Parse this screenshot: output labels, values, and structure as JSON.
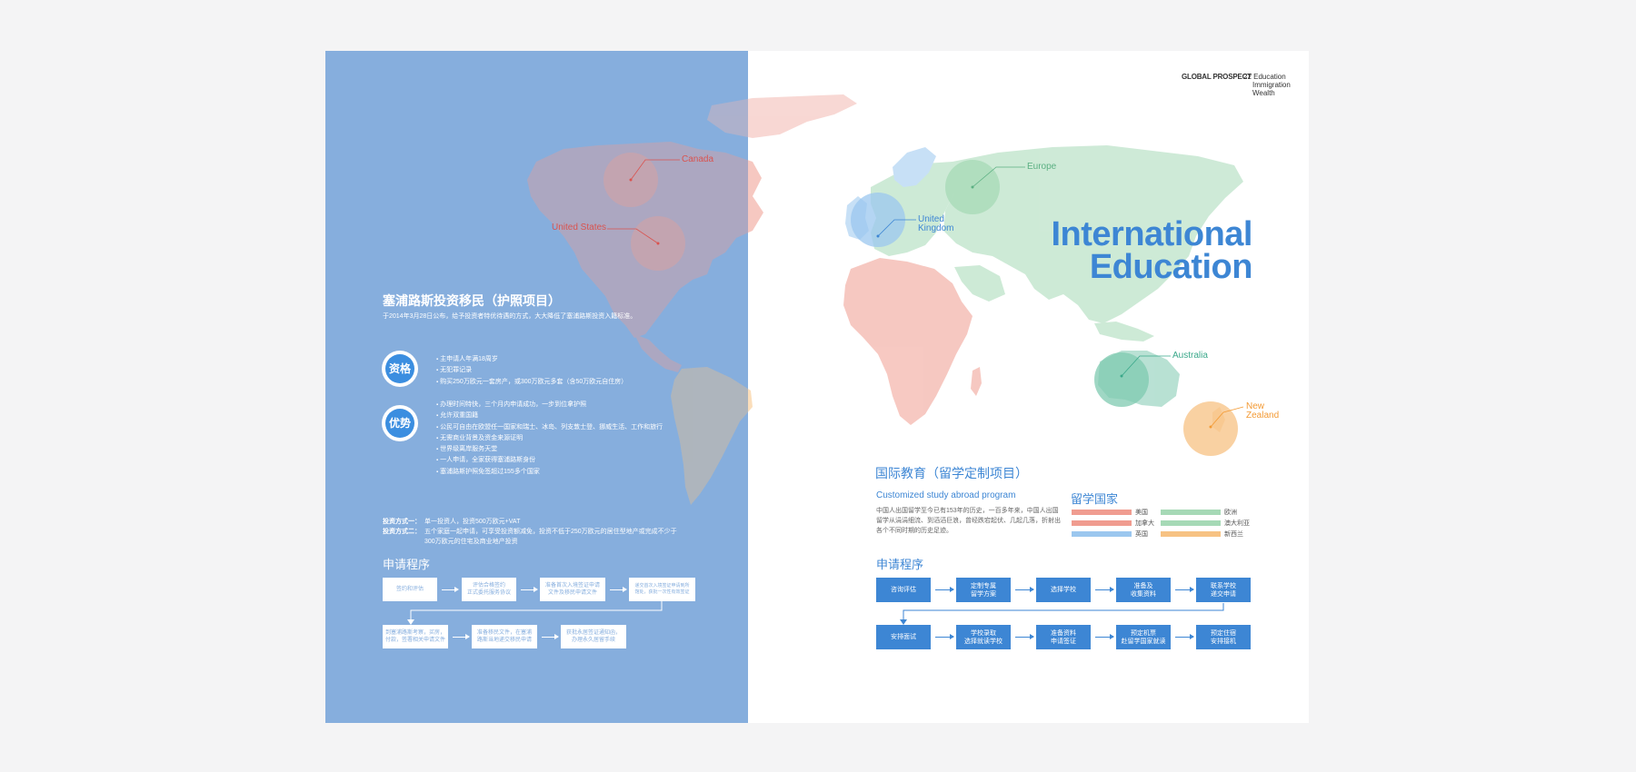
{
  "header": {
    "brand": "GLOBAL PROSPECT",
    "categories": [
      "22 Education",
      "Immigration",
      "Wealth"
    ]
  },
  "title": {
    "line1": "International",
    "line2": "Education"
  },
  "map_labels": {
    "canada": "Canada",
    "us": "United States",
    "europe": "Europe",
    "uk1": "United",
    "uk2": "Kingdom",
    "australia": "Australia",
    "nz1": "New",
    "nz2": "Zealand"
  },
  "colors": {
    "left_panel": "#86aede",
    "accent_blue": "#3d86d4",
    "na_red": "#f09c90",
    "europe_green": "#a6d9b6",
    "uk_blue": "#9bc7ef",
    "nz_orange": "#f7c283",
    "australia_teal": "#7fc9b0"
  },
  "left": {
    "title": "塞浦路斯投资移民（护照项目）",
    "subtitle": "于2014年3月28日公布，给予投资者特优待遇的方式，大大降低了塞浦路斯投资入籍标准。",
    "qual_badge": "资格",
    "qual_items": [
      "主申请人年满18周岁",
      "无犯罪记录",
      "购买250万欧元一套房产，或300万欧元多套（含50万欧元自住房）"
    ],
    "adv_badge": "优势",
    "adv_items": [
      "办理时间特快，三个月内申请成功，一步到位拿护照",
      "允许双重国籍",
      "公民可自由在欧盟任一国家和瑞士、冰岛、列支敦士登、挪威生活、工作和旅行",
      "无需商业背景及资金来源证明",
      "世界级离岸服务天堂",
      "一人申请，全家获得塞浦路斯身份",
      "塞浦路斯护照免签超过155多个国家"
    ],
    "invest_1_key": "投资方式一：",
    "invest_1_val": "单一投资人，投资500万欧元+VAT",
    "invest_2_key": "投资方式二：",
    "invest_2_val": "五个家庭一起申请，可享受投资额减免，投资不低于250万欧元的居住型地产或完成不少于",
    "invest_2_val2": "300万欧元的住宅及商业地产投资",
    "process_title": "申请程序",
    "steps": [
      [
        "签约和评估"
      ],
      [
        "评估合格签约",
        "正式委托服务协议"
      ],
      [
        "准备首次入境签证申请",
        "文件及移民申请文件"
      ],
      [
        "递交首次入境签证申请到所",
        "馆处，获批一次性有效签证"
      ],
      [
        "到塞浦路斯考察，买房，",
        "付款，签署相关申请文件"
      ],
      [
        "准备移民文件，在塞浦",
        "路斯当地递交移民申请"
      ],
      [
        "获批永居签证通知函，",
        "办理永久居留手续"
      ]
    ]
  },
  "right": {
    "title": "国际教育（留学定制项目）",
    "subtitle": "Customized study abroad program",
    "desc": "中国人出国留学至今已有153年的历史，一百多年来，中国人出国留学从涓涓细流、到滔滔巨浪，曾经跌宕起伏、几起几落，折射出各个不同时期的历史足迹。",
    "countries_title": "留学国家",
    "countries": [
      {
        "name": "美国",
        "color": "#f09c90"
      },
      {
        "name": "欧洲",
        "color": "#a6d9b6"
      },
      {
        "name": "加拿大",
        "color": "#f09c90"
      },
      {
        "name": "澳大利亚",
        "color": "#a6d9b6"
      },
      {
        "name": "英国",
        "color": "#9bc7ef"
      },
      {
        "name": "新西兰",
        "color": "#f7c283"
      }
    ],
    "process_title": "申请程序",
    "steps": [
      [
        "咨询评估"
      ],
      [
        "定制专属",
        "留学方案"
      ],
      [
        "选择学校"
      ],
      [
        "准备及",
        "收集资料"
      ],
      [
        "联系学校",
        "递交申请"
      ],
      [
        "安排面试"
      ],
      [
        "学校录取",
        "选择就读学校"
      ],
      [
        "准备资料",
        "申请签证"
      ],
      [
        "预定机票",
        "赴留学国家就读"
      ],
      [
        "预定住宿",
        "安排接机"
      ]
    ]
  }
}
